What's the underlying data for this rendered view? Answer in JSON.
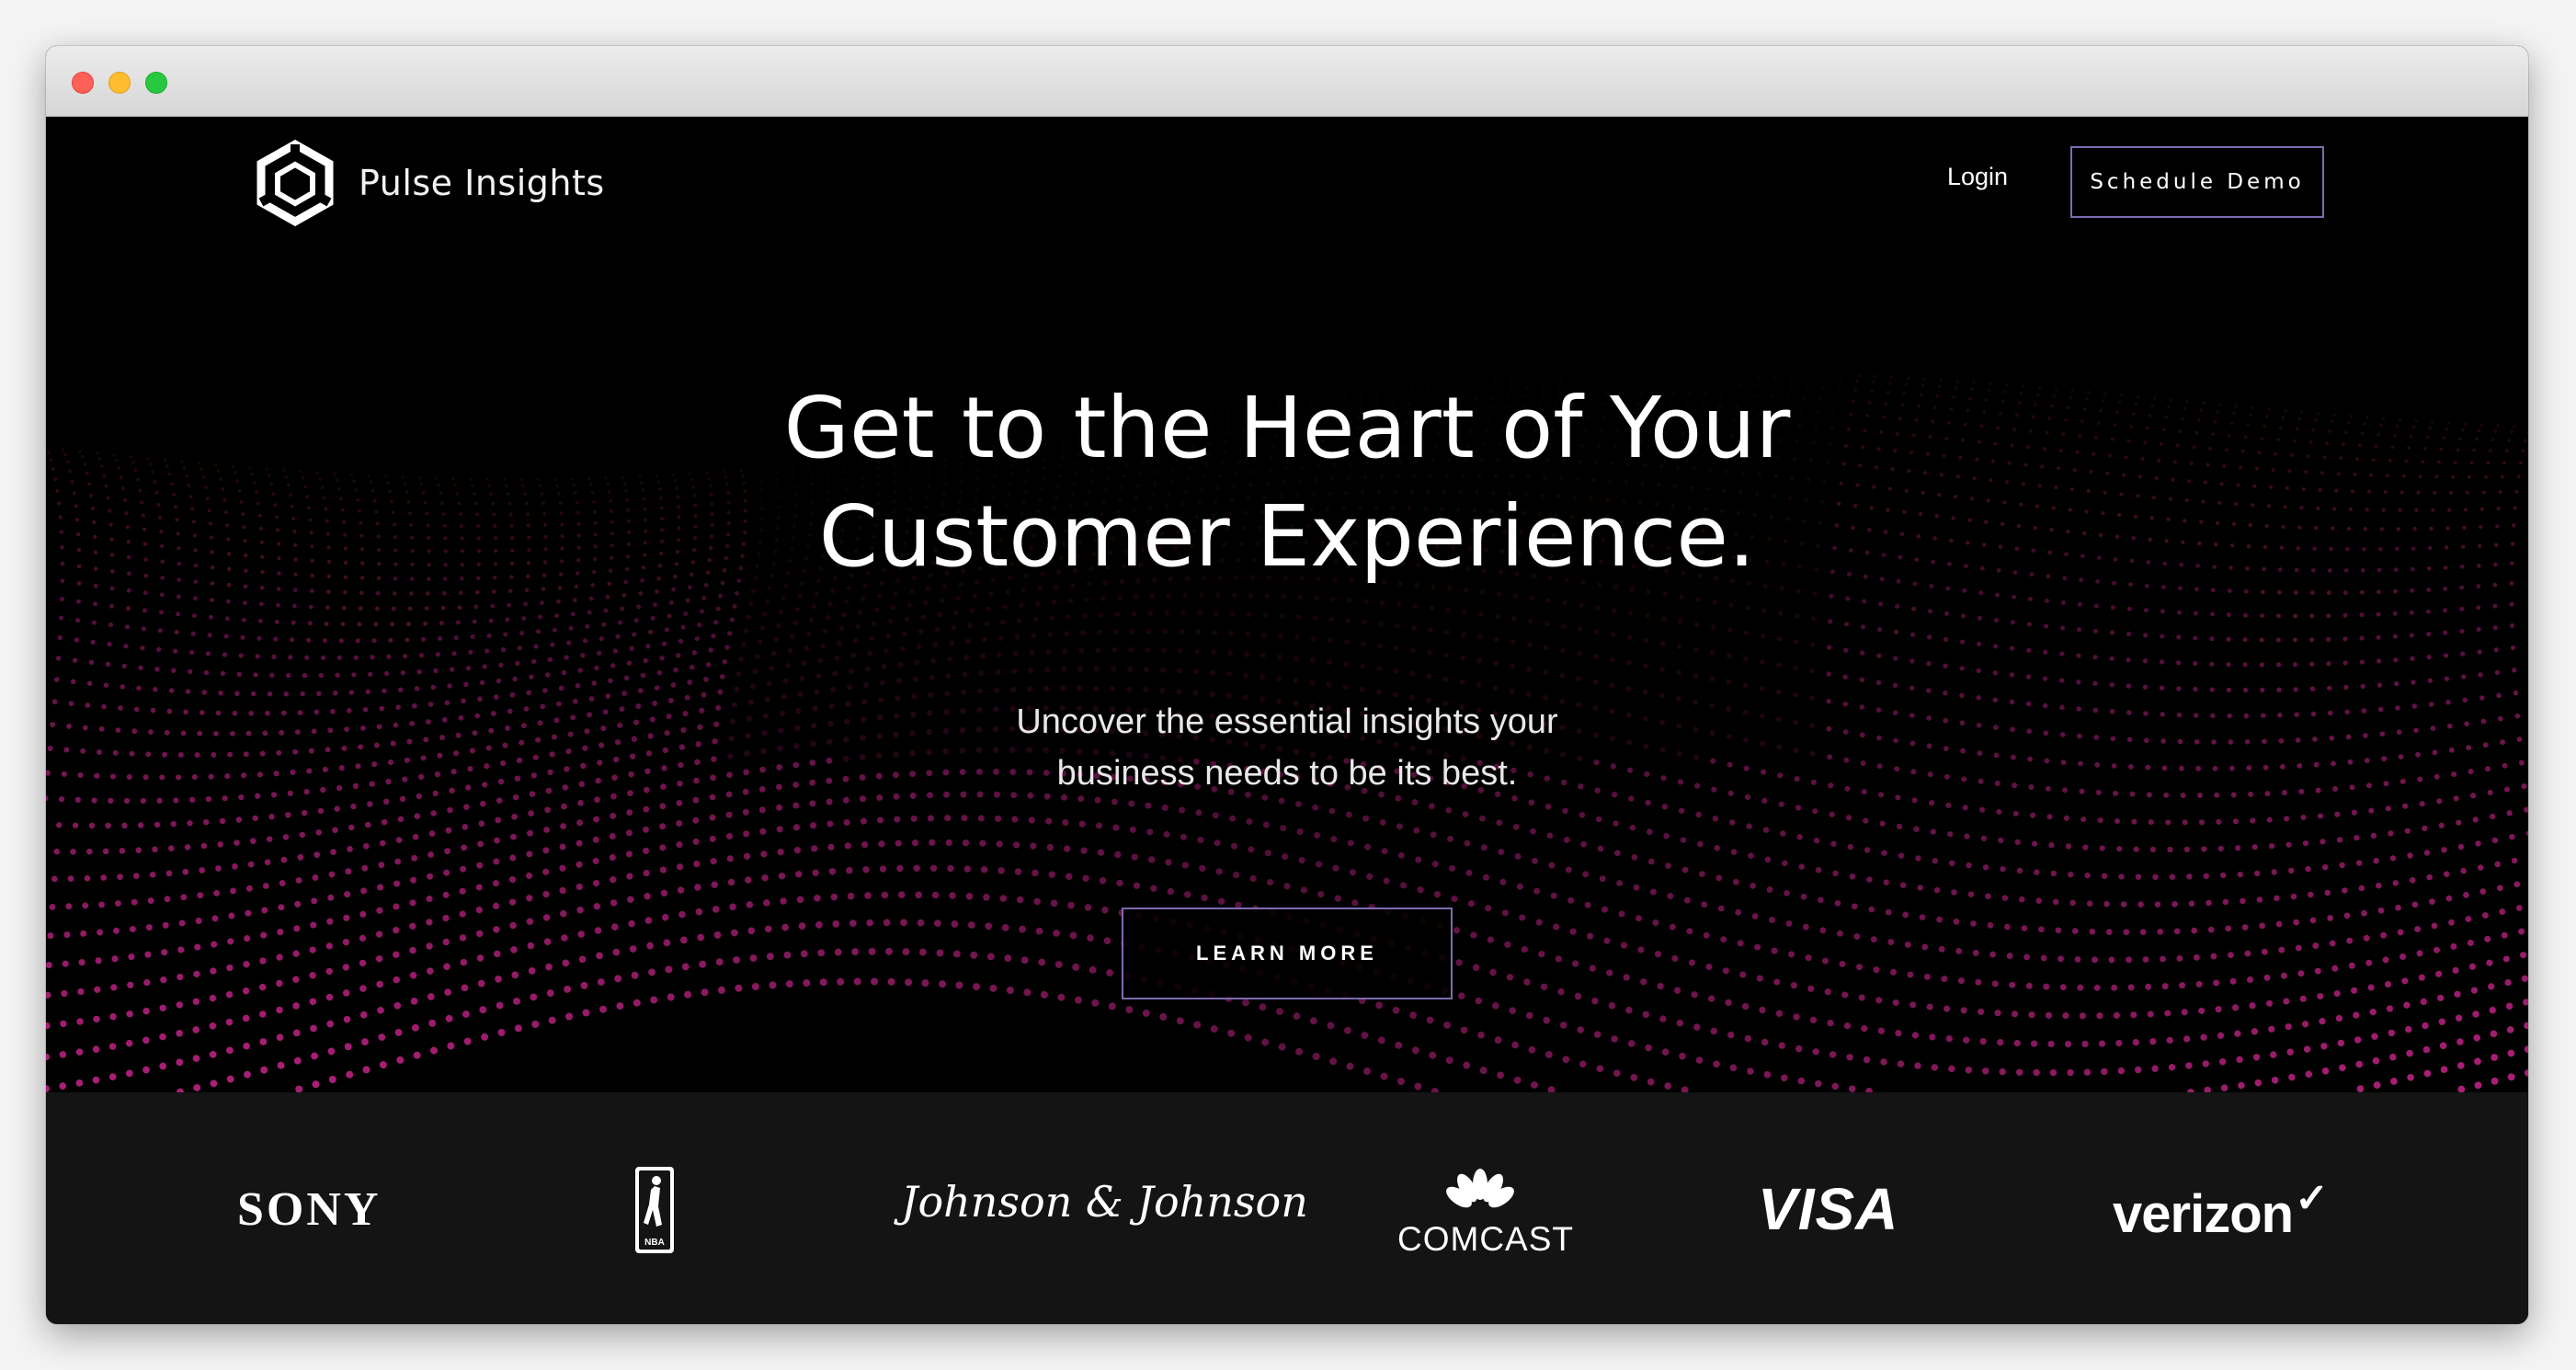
{
  "nav": {
    "brand": "Pulse Insights",
    "login_label": "Login",
    "demo_label": "Schedule Demo"
  },
  "hero": {
    "headline_line1": "Get to the Heart of Your",
    "headline_line2": "Customer Experience.",
    "sub_line1": "Uncover the essential insights your",
    "sub_line2": "business needs to be its best.",
    "cta_label": "LEARN MORE"
  },
  "clients": {
    "sony": "SONY",
    "nba": "NBA",
    "jnj": "Johnson & Johnson",
    "comcast": "COMCAST",
    "visa": "VISA",
    "verizon": "verizon",
    "verizon_check": "✓"
  },
  "colors": {
    "hero_bg": "#000000",
    "dot_color": "#b0207a",
    "button_border": "#7d6bb0",
    "client_bar_bg": "#141414"
  },
  "icons": {
    "logo": "hexagon-logo-icon",
    "window_controls": [
      "close-button",
      "minimize-button",
      "zoom-button"
    ]
  }
}
